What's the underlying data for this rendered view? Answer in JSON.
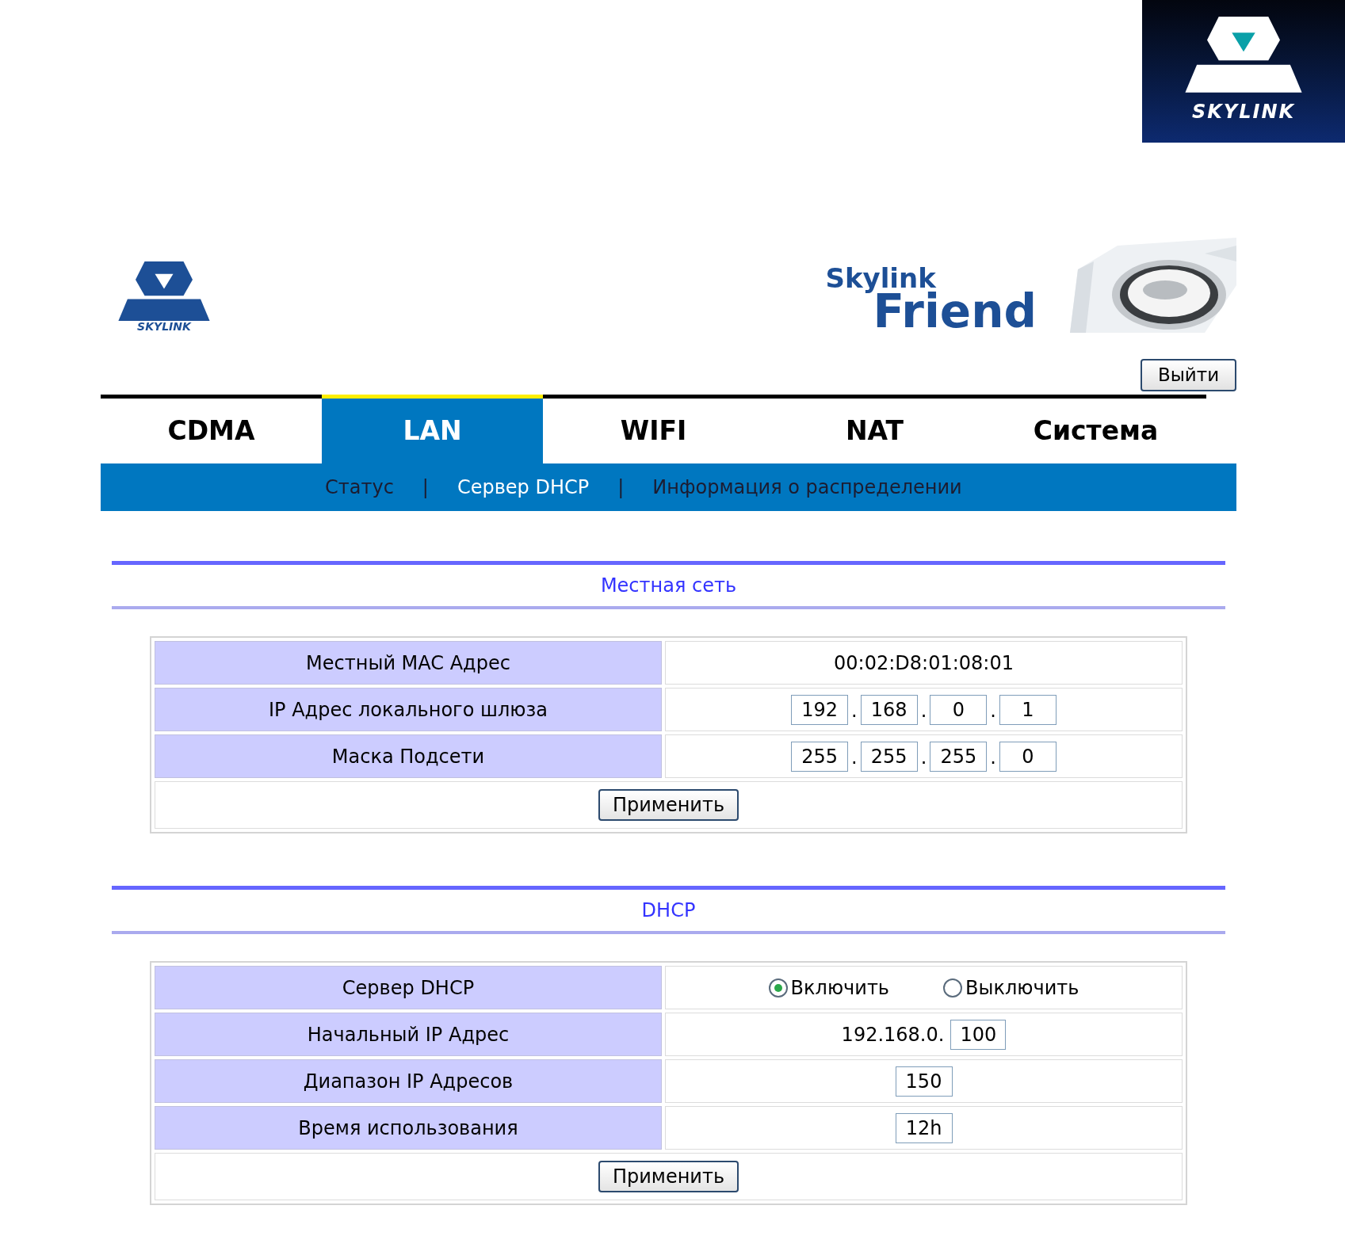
{
  "corner_logo": {
    "wordmark": "SKYLINK"
  },
  "header": {
    "logo_wordmark": "SKYLINK",
    "banner": {
      "line_1": "Skylink",
      "line_2": "Friend"
    },
    "logout_button": "Выйти"
  },
  "tabs": [
    {
      "label": "CDMA",
      "selected": false
    },
    {
      "label": "LAN",
      "selected": true
    },
    {
      "label": "WIFI",
      "selected": false
    },
    {
      "label": "NAT",
      "selected": false
    },
    {
      "label": "Система",
      "selected": false
    }
  ],
  "subnav": {
    "separator": "|",
    "items": [
      {
        "label": "Статус",
        "selected": false
      },
      {
        "label": "Сервер DHCP",
        "selected": true
      },
      {
        "label": "Информация о распределении",
        "selected": false
      }
    ]
  },
  "sections": [
    {
      "title": "Местная сеть",
      "apply_button": "Применить",
      "rows": [
        {
          "kind": "text",
          "label": "Местный MAC Адрес",
          "value": "00:02:D8:01:08:01"
        },
        {
          "kind": "ip",
          "label": "IP Адрес локального шлюза",
          "separator": ".",
          "octets": [
            "192",
            "168",
            "0",
            "1"
          ]
        },
        {
          "kind": "ip",
          "label": "Маска Подсети",
          "separator": ".",
          "octets": [
            "255",
            "255",
            "255",
            "0"
          ]
        }
      ]
    },
    {
      "title": "DHCP",
      "apply_button": "Применить",
      "rows": [
        {
          "kind": "radio",
          "label": "Сервер DHCP",
          "options": [
            {
              "label": "Включить",
              "selected": true
            },
            {
              "label": "Выключить",
              "selected": false
            }
          ]
        },
        {
          "kind": "prefixed",
          "label": "Начальный IP Адрес",
          "prefix": "192.168.0.",
          "value": "100"
        },
        {
          "kind": "input",
          "label": "Диапазон IP Адресов",
          "value": "150"
        },
        {
          "kind": "input",
          "label": "Время использования",
          "value": "12h"
        }
      ]
    }
  ]
}
